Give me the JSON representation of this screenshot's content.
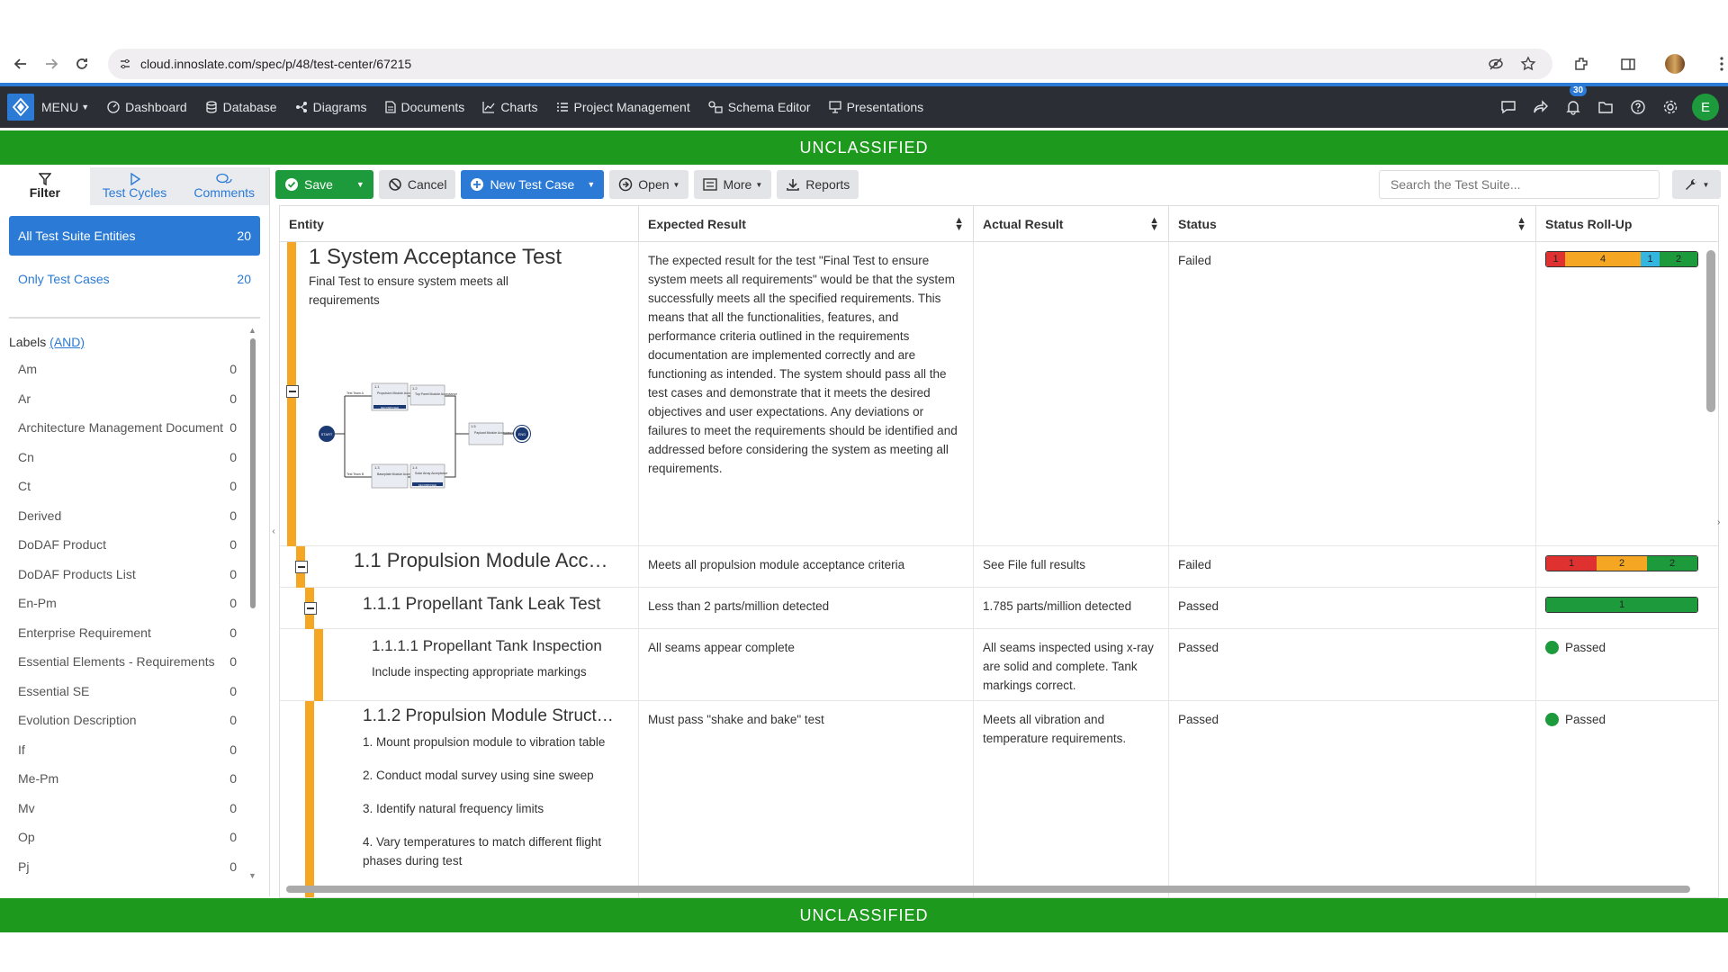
{
  "browser": {
    "url": "cloud.innoslate.com/spec/p/48/test-center/67215"
  },
  "nav": {
    "menu": "MENU",
    "items": [
      "Dashboard",
      "Database",
      "Diagrams",
      "Documents",
      "Charts",
      "Project Management",
      "Schema Editor",
      "Presentations"
    ],
    "notifications": "30",
    "avatar": "E"
  },
  "classification": "UNCLASSIFIED",
  "sidebar": {
    "tabs": [
      "Filter",
      "Test Cycles",
      "Comments"
    ],
    "filters": [
      {
        "label": "All Test Suite Entities",
        "count": "20"
      },
      {
        "label": "Only Test Cases",
        "count": "20"
      }
    ],
    "labels_title": "Labels",
    "labels_mode": "(AND)",
    "labels": [
      {
        "name": "Am",
        "count": "0"
      },
      {
        "name": "Ar",
        "count": "0"
      },
      {
        "name": "Architecture Management Document",
        "count": "0"
      },
      {
        "name": "Cn",
        "count": "0"
      },
      {
        "name": "Ct",
        "count": "0"
      },
      {
        "name": "Derived",
        "count": "0"
      },
      {
        "name": "DoDAF Product",
        "count": "0"
      },
      {
        "name": "DoDAF Products List",
        "count": "0"
      },
      {
        "name": "En-Pm",
        "count": "0"
      },
      {
        "name": "Enterprise Requirement",
        "count": "0"
      },
      {
        "name": "Essential Elements - Requirements",
        "count": "0"
      },
      {
        "name": "Essential SE",
        "count": "0"
      },
      {
        "name": "Evolution Description",
        "count": "0"
      },
      {
        "name": "If",
        "count": "0"
      },
      {
        "name": "Me-Pm",
        "count": "0"
      },
      {
        "name": "Mv",
        "count": "0"
      },
      {
        "name": "Op",
        "count": "0"
      },
      {
        "name": "Pj",
        "count": "0"
      }
    ]
  },
  "toolbar": {
    "save": "Save",
    "cancel": "Cancel",
    "new_test_case": "New Test Case",
    "open": "Open",
    "more": "More",
    "reports": "Reports",
    "search_placeholder": "Search the Test Suite..."
  },
  "grid": {
    "columns": [
      "Entity",
      "Expected Result",
      "Actual Result",
      "Status",
      "Status Roll-Up"
    ],
    "rows": [
      {
        "title": "1 System Acceptance Test",
        "desc": "Final Test to ensure system meets all requirements",
        "expected": "The expected result for the test \"Final Test to ensure system meets all requirements\" would be that the system successfully meets all the specified requirements. This means that all the functionalities, features, and performance criteria outlined in the requirements documentation are implemented correctly and are functioning as intended. The system should pass all the test cases and demonstrate that it meets the desired objectives and user expectations. Any deviations or failures to meet the requirements should be identified and addressed before considering the system as meeting all requirements.",
        "actual": "",
        "status": "Failed",
        "rollup": [
          {
            "v": "1",
            "c": "#e03131"
          },
          {
            "v": "4",
            "c": "#f5a623"
          },
          {
            "v": "1",
            "c": "#35b6e0"
          },
          {
            "v": "2",
            "c": "#1d9a3c"
          }
        ]
      },
      {
        "title": "1.1 Propulsion Module Acc…",
        "expected": "Meets all propulsion module acceptance criteria",
        "actual": "See File full results",
        "status": "Failed",
        "rollup": [
          {
            "v": "1",
            "c": "#e03131"
          },
          {
            "v": "2",
            "c": "#f5a623"
          },
          {
            "v": "2",
            "c": "#1d9a3c"
          }
        ]
      },
      {
        "title": "1.1.1 Propellant Tank Leak Test",
        "expected": "Less than 2 parts/million detected",
        "actual": "1.785 parts/million detected",
        "status": "Passed",
        "rollup": [
          {
            "v": "1",
            "c": "#1d9a3c"
          }
        ]
      },
      {
        "title": "1.1.1.1 Propellant Tank Inspection",
        "desc": "Include inspecting appropriate markings",
        "expected": "All seams appear complete",
        "actual": "All seams inspected using x-ray are solid and complete. Tank markings correct.",
        "status": "Passed",
        "rollup_text": "Passed"
      },
      {
        "title": "1.1.2 Propulsion Module Struct…",
        "steps": [
          "1. Mount propulsion module to vibration table",
          "2. Conduct modal survey using sine sweep",
          "3. Identify natural frequency limits",
          "4. Vary temperatures to match different flight phases during test"
        ],
        "expected": "Must pass \"shake and bake\" test",
        "actual": "Meets all vibration and temperature requirements.",
        "status": "Passed",
        "rollup_text": "Passed"
      }
    ]
  },
  "diagram": {
    "start": "START",
    "end": "END",
    "nodes": [
      {
        "num": "1.1",
        "name": "Propulsion Module Acceptance Test"
      },
      {
        "num": "1.2",
        "name": "Top Panel Module Acceptance"
      },
      {
        "num": "1.3",
        "name": "Baseplate Module Acceptance"
      },
      {
        "num": "1.4",
        "name": "Solar Array Acceptance"
      },
      {
        "num": "1.5",
        "name": "Payload Module Acceptance"
      }
    ],
    "branch_labels": [
      "Test Team A",
      "Test Team B"
    ],
    "tag": "DECOMPOSED"
  }
}
